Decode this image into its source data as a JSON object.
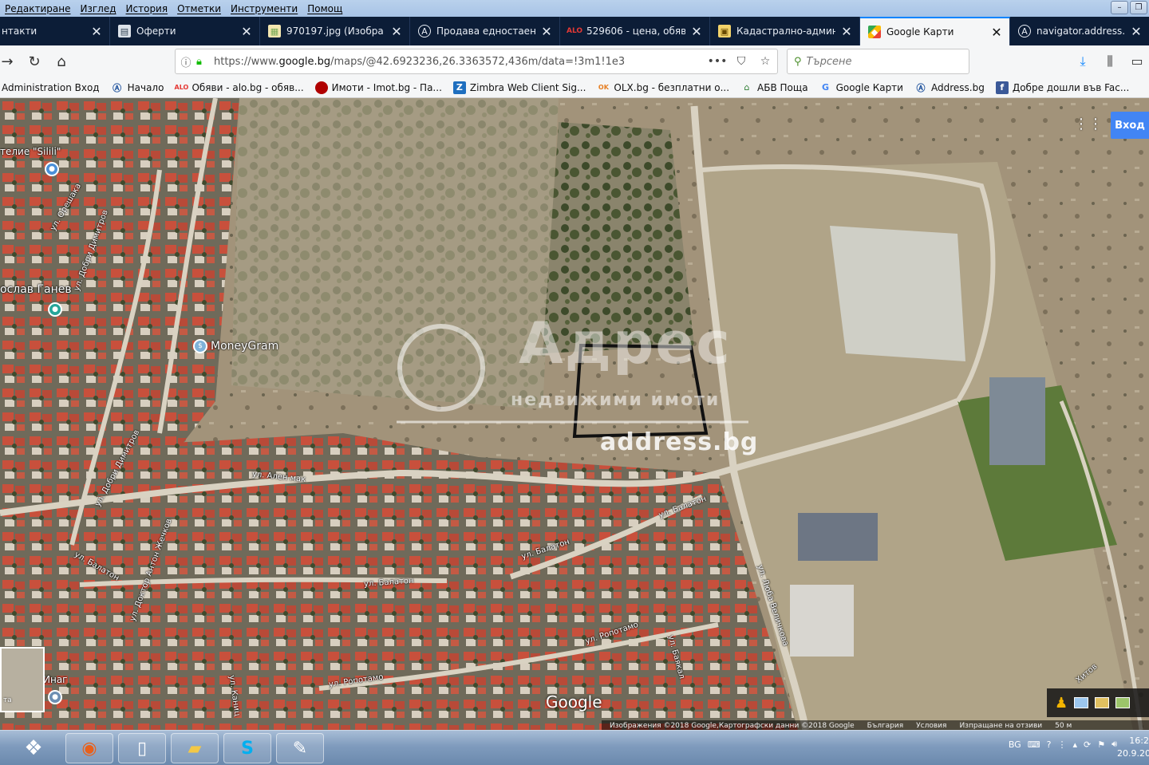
{
  "menubar": {
    "items": [
      "Редактиране",
      "Изглед",
      "История",
      "Отметки",
      "Инструменти",
      "Помощ"
    ]
  },
  "tabs": [
    {
      "label": "нтакти",
      "icon": "contacts-icon",
      "active": false
    },
    {
      "label": "Оферти",
      "icon": "page-icon",
      "active": false
    },
    {
      "label": "970197.jpg (Изобра",
      "icon": "image-icon",
      "active": false
    },
    {
      "label": "Продава едностаен а",
      "icon": "address-icon",
      "active": false
    },
    {
      "label": "529606 - цена, обяви",
      "icon": "alo-icon",
      "active": false
    },
    {
      "label": "Кадастрално-админи",
      "icon": "cadastre-icon",
      "active": false
    },
    {
      "label": "Google Карти",
      "icon": "google-maps-icon",
      "active": true
    },
    {
      "label": "navigator.address.bg",
      "icon": "address-icon",
      "active": false
    }
  ],
  "navbar": {
    "url_prefix": "https://www.",
    "url_host": "google.bg",
    "url_path": "/maps/@42.6923236,26.3363572,436m/data=!3m1!1e3",
    "more": "•••",
    "search_placeholder": "Търсене"
  },
  "bookmarks": [
    {
      "label": "Administration Вход",
      "icon": ""
    },
    {
      "label": "Начало",
      "icon": "address-icon"
    },
    {
      "label": "Обяви - alo.bg - обяв...",
      "icon": "alo-icon"
    },
    {
      "label": "Имоти - Imot.bg - Па...",
      "icon": "imot-icon"
    },
    {
      "label": "Zimbra Web Client Sig...",
      "icon": "zimbra-icon"
    },
    {
      "label": "OLX.bg - безплатни о...",
      "icon": "olx-icon"
    },
    {
      "label": "АБВ Поща",
      "icon": "abv-icon"
    },
    {
      "label": "Google Карти",
      "icon": "google-icon"
    },
    {
      "label": "Address.bg",
      "icon": "address-icon"
    },
    {
      "label": "Добре дошли във Fac...",
      "icon": "facebook-icon"
    }
  ],
  "map": {
    "signin": "Вход",
    "places": {
      "atelier": "телие \"Silili\"",
      "person": "ослав Ганев",
      "moneygram": "MoneyGram",
      "bottom_left": "Инаг"
    },
    "streets": {
      "oreshaka": "ул. Орешака",
      "dobri_left": "ул. Добри Димитров",
      "dobri_top": "ул. Добри Димитров",
      "alen_mak": "ул. Ален мак",
      "balaton_left": "ул. Балатон",
      "balaton_center": "ул. Балатон",
      "balaton_mid": "ул. Балатон",
      "balaton_right": "ул. Балатон",
      "zhechkov": "ул. Доктор Антон Жечков",
      "ropotamo_center": "ул. Ропотамо",
      "ropotamo_bottom": "ул. Ропотамо",
      "bayakal": "ул. Баякал",
      "kanich": "ул. Каниц",
      "lyuba": "ул. Люба Величкова",
      "hitov": "Хитов"
    },
    "watermark": {
      "brand": "Адрес",
      "subtitle": "недвижими имоти",
      "site": "address.bg"
    },
    "google_logo": "Google",
    "footer": {
      "imagery": "Изображения ©2018 Google,Картографски данни ©2018 Google",
      "country": "България",
      "terms": "Условия",
      "feedback": "Изпращане на отзиви",
      "scale": "50 м"
    },
    "minimap_label": "та"
  },
  "taskbar": {
    "language": "BG",
    "time": "16:2",
    "date": "20.9.20"
  }
}
